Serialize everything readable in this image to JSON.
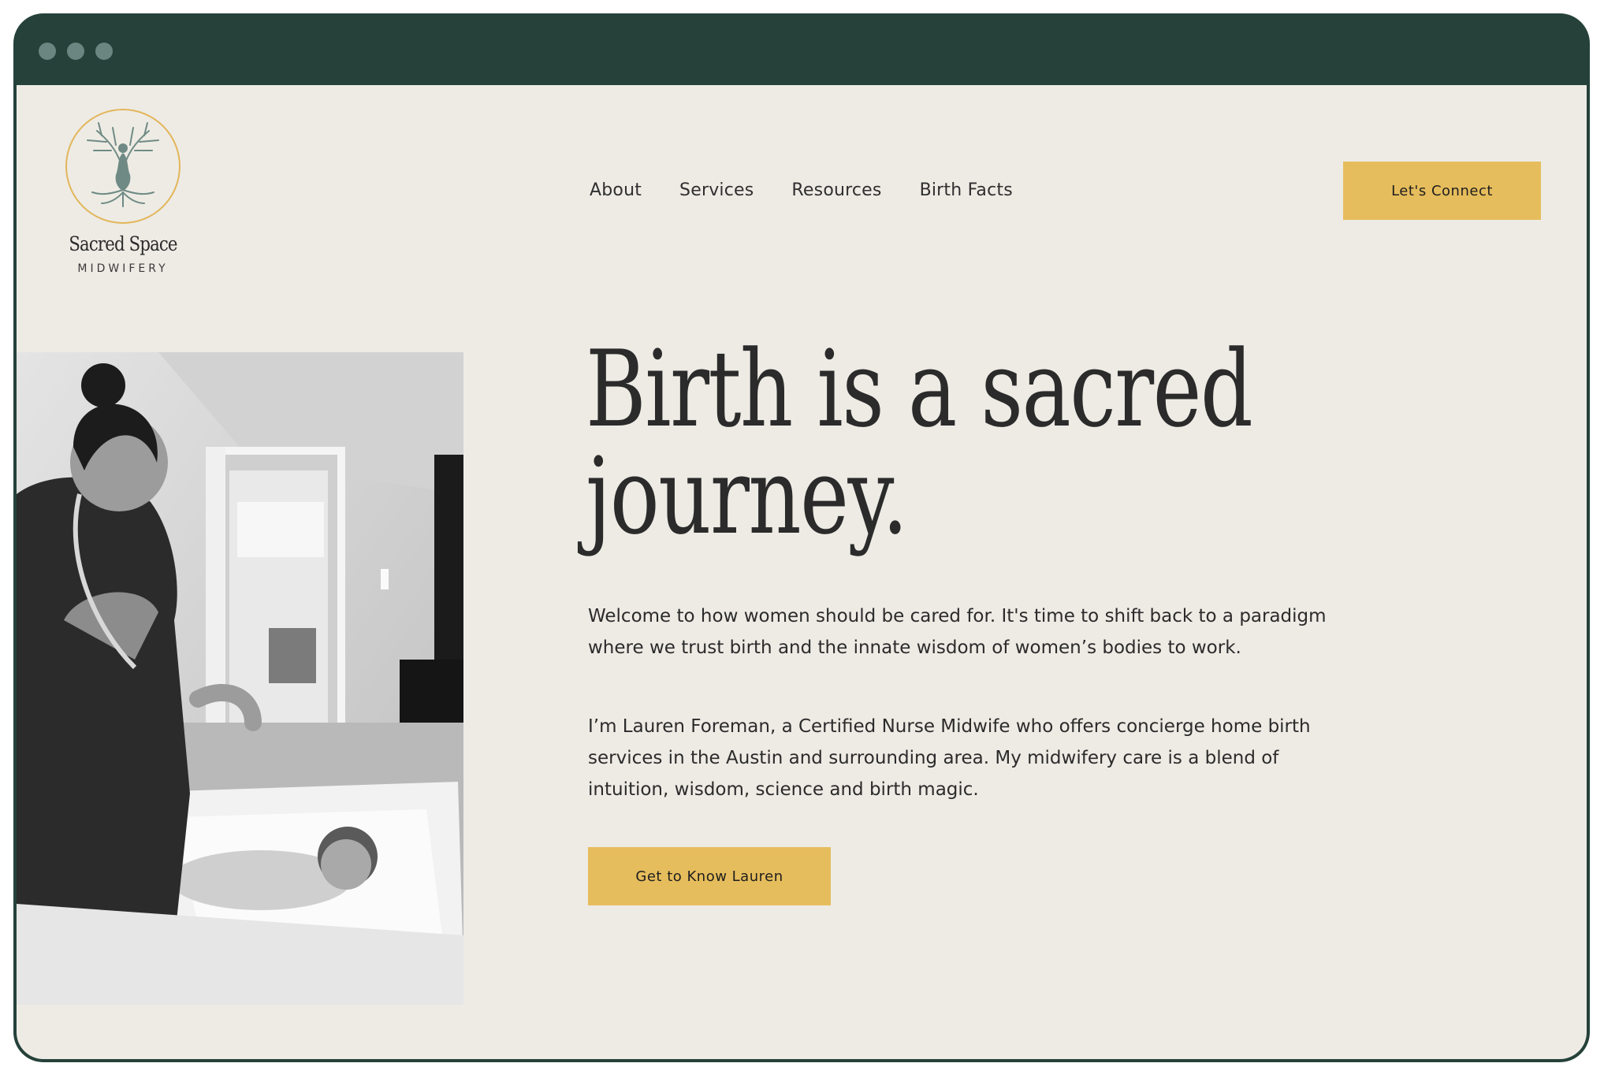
{
  "brand": {
    "name": "Sacred Space",
    "subtitle": "MIDWIFERY",
    "logo_icon": "tree-of-life-woman-icon",
    "accent_color": "#e6bd5c",
    "frame_color": "#25413a",
    "background_color": "#eeebe5"
  },
  "nav": {
    "items": [
      {
        "label": "About"
      },
      {
        "label": "Services"
      },
      {
        "label": "Resources"
      },
      {
        "label": "Birth Facts"
      }
    ],
    "cta_label": "Let's Connect"
  },
  "hero": {
    "headline_line1": "Birth is a sacred",
    "headline_line2": "journey.",
    "paragraph1": "Welcome to how women should be cared for. It's time to shift back to a paradigm where we trust birth and the innate wisdom of women’s bodies to work.",
    "paragraph2": "I’m Lauren Foreman, a Certified Nurse Midwife who offers concierge home birth services in the Austin and surrounding area. My midwifery care is a blend of intuition, wisdom, science and birth magic.",
    "cta_label": "Get to Know Lauren"
  }
}
